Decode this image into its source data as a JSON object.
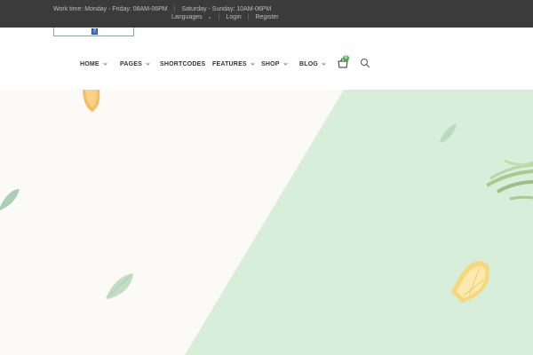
{
  "topbar": {
    "work_time": "Work time: Monday - Friday: 08AM-06PM",
    "weekend": "Saturday - Sunday: 10AM-06PM",
    "languages": "Languages",
    "login": "Login",
    "register": "Register"
  },
  "logo": {
    "alt_icon": "broken-image-icon"
  },
  "nav": {
    "items": [
      {
        "label": "HOME",
        "dropdown": true
      },
      {
        "label": "PAGES",
        "dropdown": true
      },
      {
        "label": "SHORTCODES",
        "dropdown": false
      },
      {
        "label": "FEATURES",
        "dropdown": true
      },
      {
        "label": "SHOP",
        "dropdown": true
      },
      {
        "label": "BLOG",
        "dropdown": true
      }
    ],
    "cart_count": "0",
    "cart_icon": "shopping-bag-icon",
    "search_icon": "search-icon"
  },
  "hero": {
    "bg_light": "#fbfaf6",
    "bg_green": "#d7eedb",
    "decor": [
      "orange-slice",
      "leaf",
      "herb-sprig",
      "lemon-slice"
    ]
  },
  "colors": {
    "topbar": "#3b3b3b",
    "badge": "#4caf50",
    "nav_text": "#333333"
  }
}
